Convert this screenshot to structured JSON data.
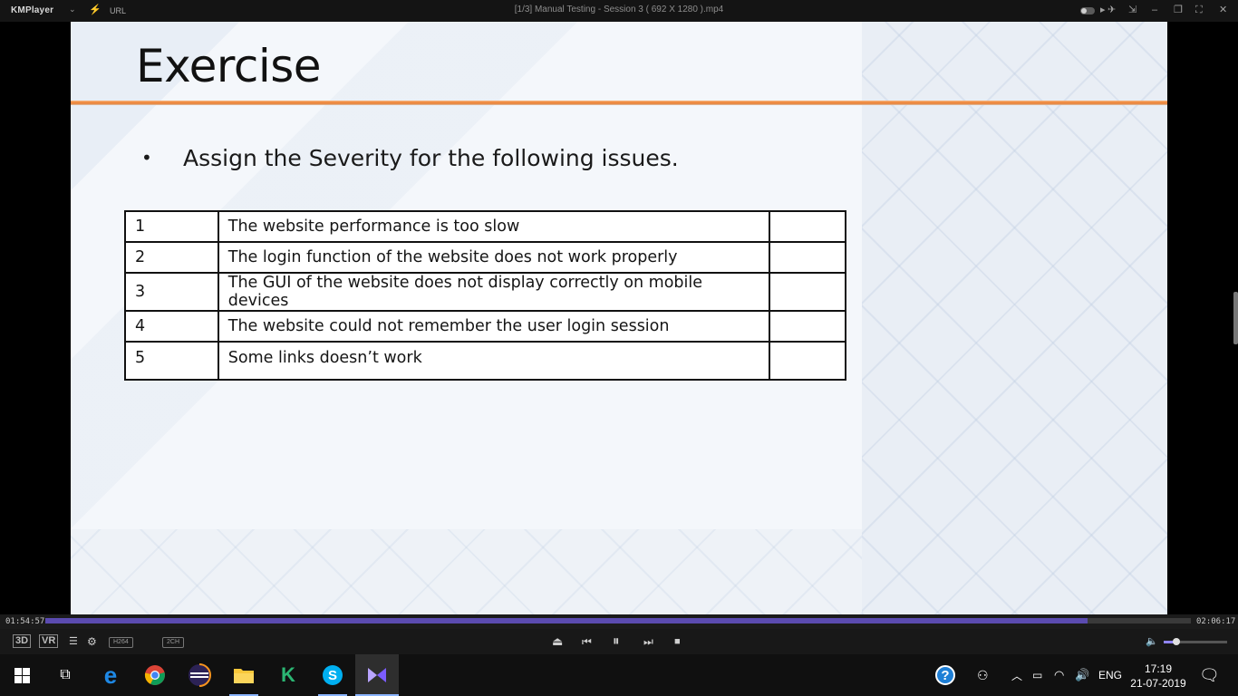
{
  "player": {
    "logo": "KMPlayer",
    "logo_dropdown": "⌄",
    "url_label": "URL",
    "window_title": "[1/3] Manual Testing - Session 3 ( 692 X 1280 ).mp4"
  },
  "slide": {
    "title": "Exercise",
    "bullet": "Assign the Severity for the following issues.",
    "table": {
      "rows": [
        {
          "num": "1",
          "issue": "The website performance is too slow",
          "severity": ""
        },
        {
          "num": "2",
          "issue": "The login function of the website does not work properly",
          "severity": ""
        },
        {
          "num": "3",
          "issue": "The GUI of the website does not display correctly on mobile devices",
          "severity": ""
        },
        {
          "num": "4",
          "issue": "The website could not remember the user login session",
          "severity": ""
        },
        {
          "num": "5",
          "issue": "Some links doesn’t work",
          "severity": ""
        }
      ]
    }
  },
  "playback": {
    "elapsed": "01:54:57",
    "total": "02:06:17",
    "progress": 0.91,
    "volume": 0.2,
    "labels": {
      "three_d": "3D",
      "vr": "VR",
      "codec": "H264",
      "channels": "2CH"
    }
  },
  "taskbar": {
    "apps": [
      {
        "name": "task-view",
        "icon": "task-view-icon"
      },
      {
        "name": "edge",
        "icon": "edge-icon"
      },
      {
        "name": "chrome",
        "icon": "chrome-icon"
      },
      {
        "name": "eclipse",
        "icon": "eclipse-icon"
      },
      {
        "name": "file-explorer",
        "icon": "folder-icon"
      },
      {
        "name": "katalon",
        "icon": "katalon-icon"
      },
      {
        "name": "skype",
        "icon": "skype-icon"
      },
      {
        "name": "kmplayer",
        "icon": "kmplayer-icon"
      }
    ],
    "language": "ENG",
    "time": "17:19",
    "date": "21-07-2019"
  }
}
